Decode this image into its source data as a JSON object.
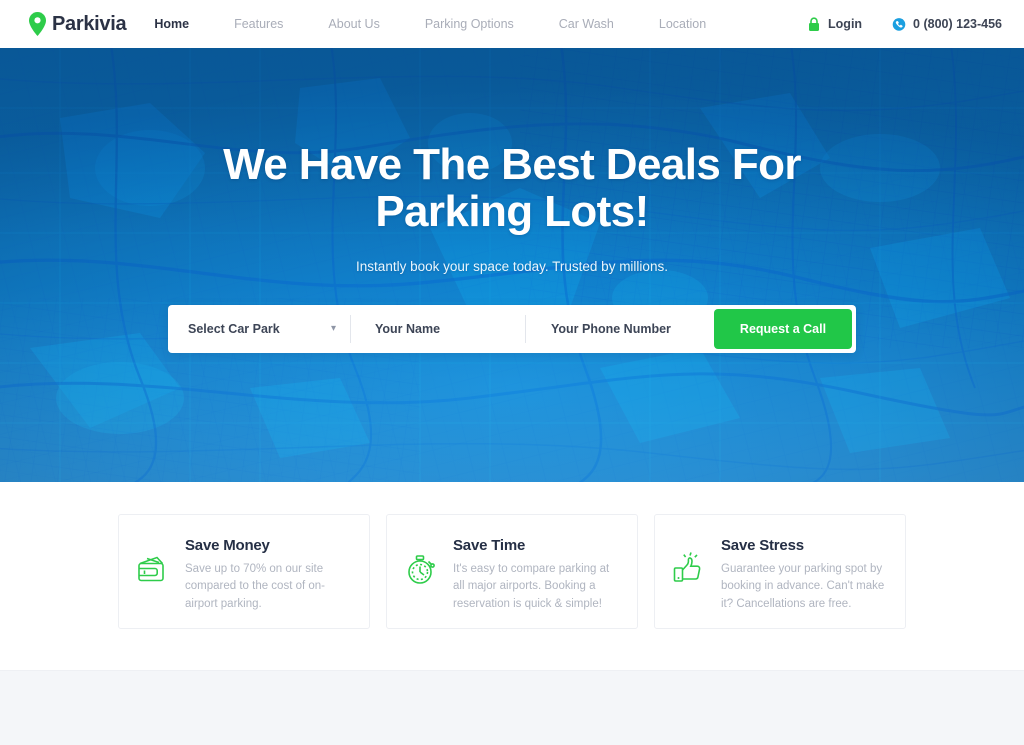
{
  "header": {
    "brand": {
      "name": "Parkivia",
      "icon": "map-pin-icon",
      "pin_color": "#2ecc4a"
    },
    "nav": [
      {
        "label": "Home",
        "active": true
      },
      {
        "label": "Features",
        "active": false
      },
      {
        "label": "About Us",
        "active": false
      },
      {
        "label": "Parking Options",
        "active": false
      },
      {
        "label": "Car Wash",
        "active": false
      },
      {
        "label": "Location",
        "active": false
      }
    ],
    "login": {
      "label": "Login",
      "icon": "lock-icon",
      "icon_color": "#2ecc4a"
    },
    "phone": {
      "label": "0 (800) 123-456",
      "icon": "phone-icon",
      "icon_color": "#1b9fe0"
    }
  },
  "hero": {
    "title_line1": "We Have The Best Deals For",
    "title_line2": "Parking Lots!",
    "subtitle": "Instantly book your space today. Trusted by millions.",
    "background_color": "#1182ce",
    "background_texture": "city-map-texture"
  },
  "search_form": {
    "select": {
      "value": "Select Car Park",
      "caret_icon": "chevron-down-icon"
    },
    "name_field": {
      "placeholder": "Your Name",
      "value": ""
    },
    "phone_field": {
      "placeholder": "Your Phone Number",
      "value": ""
    },
    "submit": {
      "label": "Request a Call",
      "color": "#21c748"
    }
  },
  "features": [
    {
      "icon": "wallet-icon",
      "title": "Save Money",
      "text": "Save up to 70% on our site compared to the cost of on-airport parking."
    },
    {
      "icon": "stopwatch-icon",
      "title": "Save Time",
      "text": "It's easy to compare parking at all major airports. Booking a reservation is quick & simple!"
    },
    {
      "icon": "thumbs-up-icon",
      "title": "Save Stress",
      "text": "Guarantee your parking spot by booking in advance. Can't make it? Cancellations are free."
    }
  ],
  "colors": {
    "accent_green": "#2ecc4a",
    "hero_blue": "#1182ce",
    "heading_navy": "#252f45",
    "muted_gray": "#b0b5c0"
  }
}
